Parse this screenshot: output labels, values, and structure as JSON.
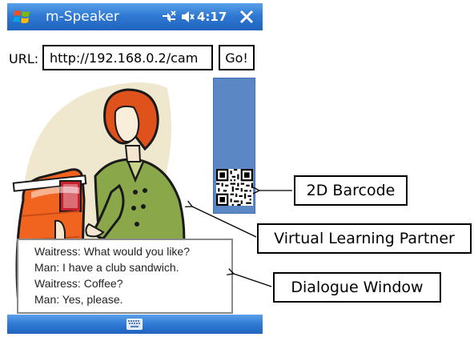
{
  "titlebar": {
    "app_title": "m-Speaker",
    "time": "4:17",
    "icons": {
      "start": "windows-start-icon",
      "connectivity": "connectivity-icon",
      "volume": "volume-icon",
      "close": "close-icon"
    }
  },
  "url_bar": {
    "label": "URL:",
    "value": "http://192.168.0.2/cam",
    "go_label": "Go!"
  },
  "illustration": {
    "subject": "waitress-at-counter-illustration"
  },
  "barcode_panel": {
    "icon": "qr-code-icon",
    "color": "#5b87c5"
  },
  "dialogue": {
    "lines": [
      "Waitress: What would you like?",
      "Man: I have a club sandwich.",
      "Waitress: Coffee?",
      "Man: Yes, please."
    ]
  },
  "taskbar": {
    "icon": "keyboard-icon"
  },
  "callouts": {
    "barcode": "2D Barcode",
    "partner": "Virtual Learning Partner",
    "dialogue": "Dialogue Window"
  },
  "colors": {
    "titlebar_top": "#5aa0ea",
    "titlebar_bottom": "#1f63bd",
    "shirt_green": "#8aa84a",
    "hair_orange": "#e0521c",
    "register_orange": "#f06420"
  }
}
